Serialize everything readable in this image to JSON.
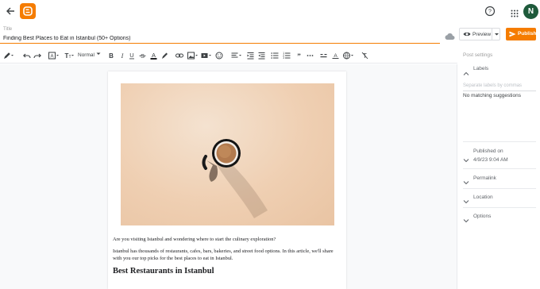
{
  "header": {
    "back_icon": "arrow-left-icon",
    "logo_icon": "blogger-logo-icon",
    "help_icon": "help-circle-icon",
    "apps_icon": "apps-grid-icon",
    "avatar_initial": "N",
    "brand_color": "#f57c00"
  },
  "title_bar": {
    "caption": "Title",
    "value": "Finding Best Places to Eat in Istanbul (50+ Options)",
    "cloud_icon": "cloud-saved-icon",
    "preview_label": "Preview",
    "publish_label": "Publish"
  },
  "toolbar": {
    "paragraph_style": "Normal",
    "items": [
      "pencil-icon",
      "undo-icon",
      "redo-icon",
      "font-family-icon",
      "font-size-icon",
      "bold-icon",
      "italic-icon",
      "underline-icon",
      "strikethrough-icon",
      "text-color-icon",
      "highlight-icon",
      "link-icon",
      "image-icon",
      "video-icon",
      "emoji-icon",
      "align-icon",
      "indent-icon",
      "outdent-icon",
      "bulleted-list-icon",
      "numbered-list-icon",
      "quote-icon",
      "more-icon",
      "special-characters-icon",
      "formatting-icon",
      "translit-icon",
      "clear-formatting-icon"
    ]
  },
  "post": {
    "image_icon": "coffee-cup-photo",
    "paragraph1": "Are you visiting Istanbul and wondering where to start the culinary exploration?",
    "paragraph2": "Istanbul has thousands of restaurants, cafes, bars, bakeries, and street food options. In this article, we'll share with you our top picks for the best places to eat in Istanbul.",
    "heading": "Best Restaurants in Istanbul"
  },
  "sidebar": {
    "title": "Post settings",
    "labels": "Labels",
    "labels_hint": "Separate labels by commas",
    "no_match": "No matching suggestions",
    "published_on": "Published on",
    "published_date": "4/9/23 9:04 AM",
    "permalink": "Permalink",
    "location": "Location",
    "options": "Options"
  }
}
